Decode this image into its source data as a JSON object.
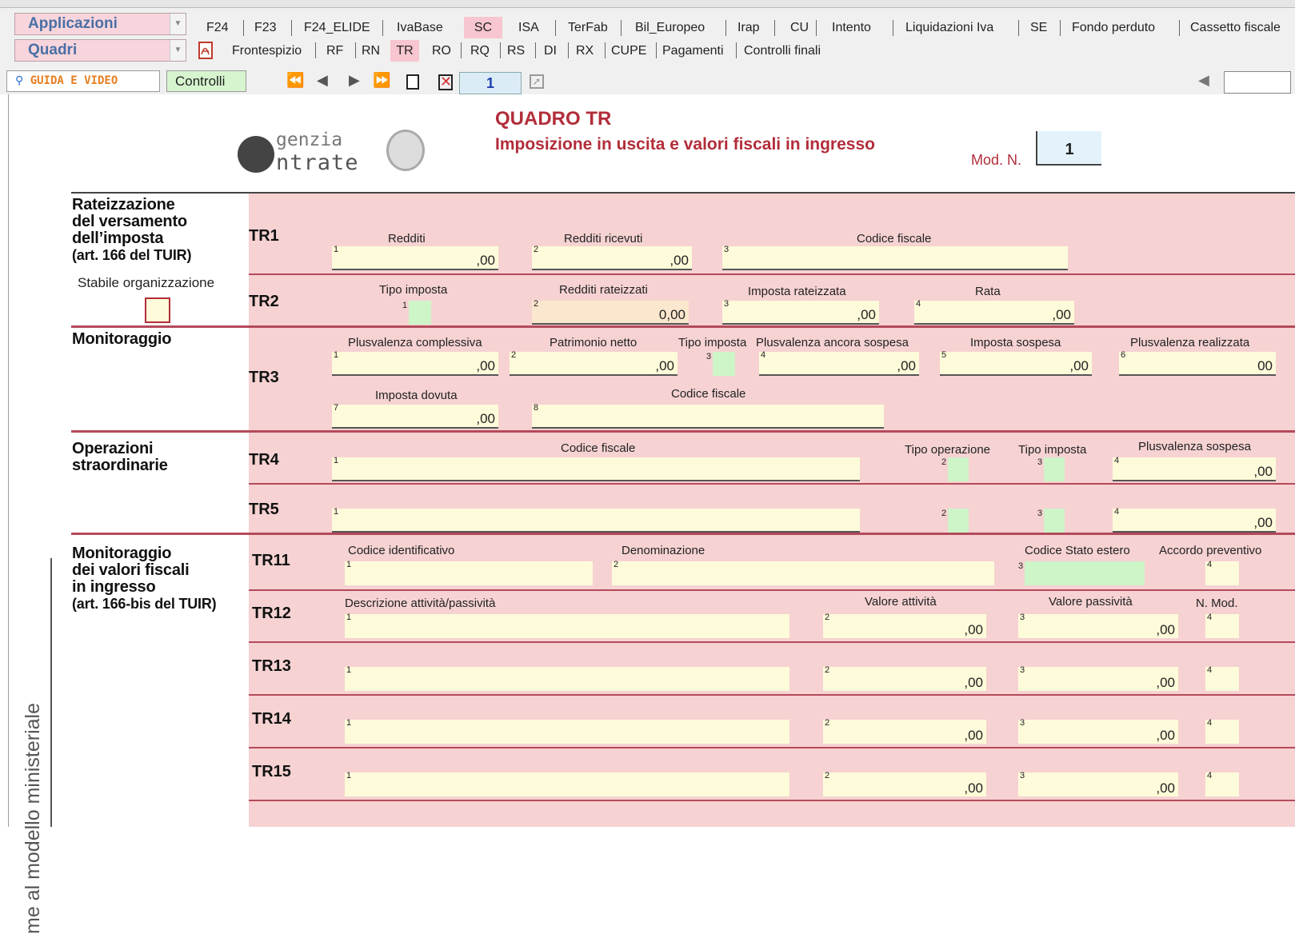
{
  "toolbar": {
    "app_combo": "Applicazioni",
    "quadri_combo": "Quadri",
    "tabs_top": [
      "F24",
      "F23",
      "F24_ELIDE",
      "IvaBase",
      "SC",
      "ISA",
      "TerFab",
      "Bil_Europeo",
      "Irap",
      "CU",
      "Intento",
      "Liquidazioni Iva",
      "SE",
      "Fondo perduto",
      "Cassetto fiscale"
    ],
    "tabs_bottom": [
      "Frontespizio",
      "RF",
      "RN",
      "TR",
      "RO",
      "RQ",
      "RS",
      "DI",
      "RX",
      "CUPE",
      "Pagamenti",
      "Controlli finali"
    ],
    "guida_label": "GUIDA E VIDEO",
    "controlli_label": "Controlli",
    "page_number": "1",
    "selected_top": "SC",
    "selected_bottom": "TR"
  },
  "header": {
    "logo_line1": "genzia",
    "logo_line2": "ntrate",
    "title": "QUADRO TR",
    "subtitle": "Imposizione in uscita e valori fiscali in ingresso",
    "mod_label": "Mod. N.",
    "mod_value": "1"
  },
  "sections": {
    "s1": [
      "Rateizzazione",
      "del versamento",
      "dell’imposta",
      "(art. 166 del TUIR)"
    ],
    "stabile": "Stabile organizzazione",
    "s2": [
      "Monitoraggio"
    ],
    "s3": [
      "Operazioni",
      "straordinarie"
    ],
    "s4": [
      "Monitoraggio",
      "dei valori fiscali",
      "in ingresso",
      "(art. 166-bis del TUIR)"
    ]
  },
  "rows": {
    "TR1": {
      "label": "TR1",
      "f1": "Redditi",
      "f2": "Redditi ricevuti",
      "f3": "Codice fiscale"
    },
    "TR2": {
      "label": "TR2",
      "f1": "Tipo imposta",
      "f2": "Redditi rateizzati",
      "f2_value": "0",
      "f3": "Imposta rateizzata",
      "f4": "Rata"
    },
    "TR3": {
      "label": "TR3",
      "f1": "Plusvalenza complessiva",
      "f2": "Patrimonio netto",
      "f3": "Tipo imposta",
      "f4": "Plusvalenza ancora sospesa",
      "f5": "Imposta sospesa",
      "f6": "Plusvalenza realizzata",
      "f7": "Imposta dovuta",
      "f8": "Codice fiscale"
    },
    "TR4": {
      "label": "TR4",
      "f1": "Codice fiscale",
      "f2": "Tipo operazione",
      "f3": "Tipo imposta",
      "f4": "Plusvalenza sospesa"
    },
    "TR5": {
      "label": "TR5"
    },
    "TR11": {
      "label": "TR11",
      "f1": "Codice identificativo",
      "f2": "Denominazione",
      "f3": "Codice Stato estero",
      "f4": "Accordo preventivo"
    },
    "TR12": {
      "label": "TR12",
      "f1": "Descrizione attività/passività",
      "f2": "Valore attività",
      "f3": "Valore passività",
      "f4": "N. Mod."
    },
    "TR13": {
      "label": "TR13"
    },
    "TR14": {
      "label": "TR14"
    },
    "TR15": {
      "label": "TR15"
    }
  },
  "decimals": ",00",
  "decimals_plain": "00",
  "side_text": "me al modello ministeriale"
}
